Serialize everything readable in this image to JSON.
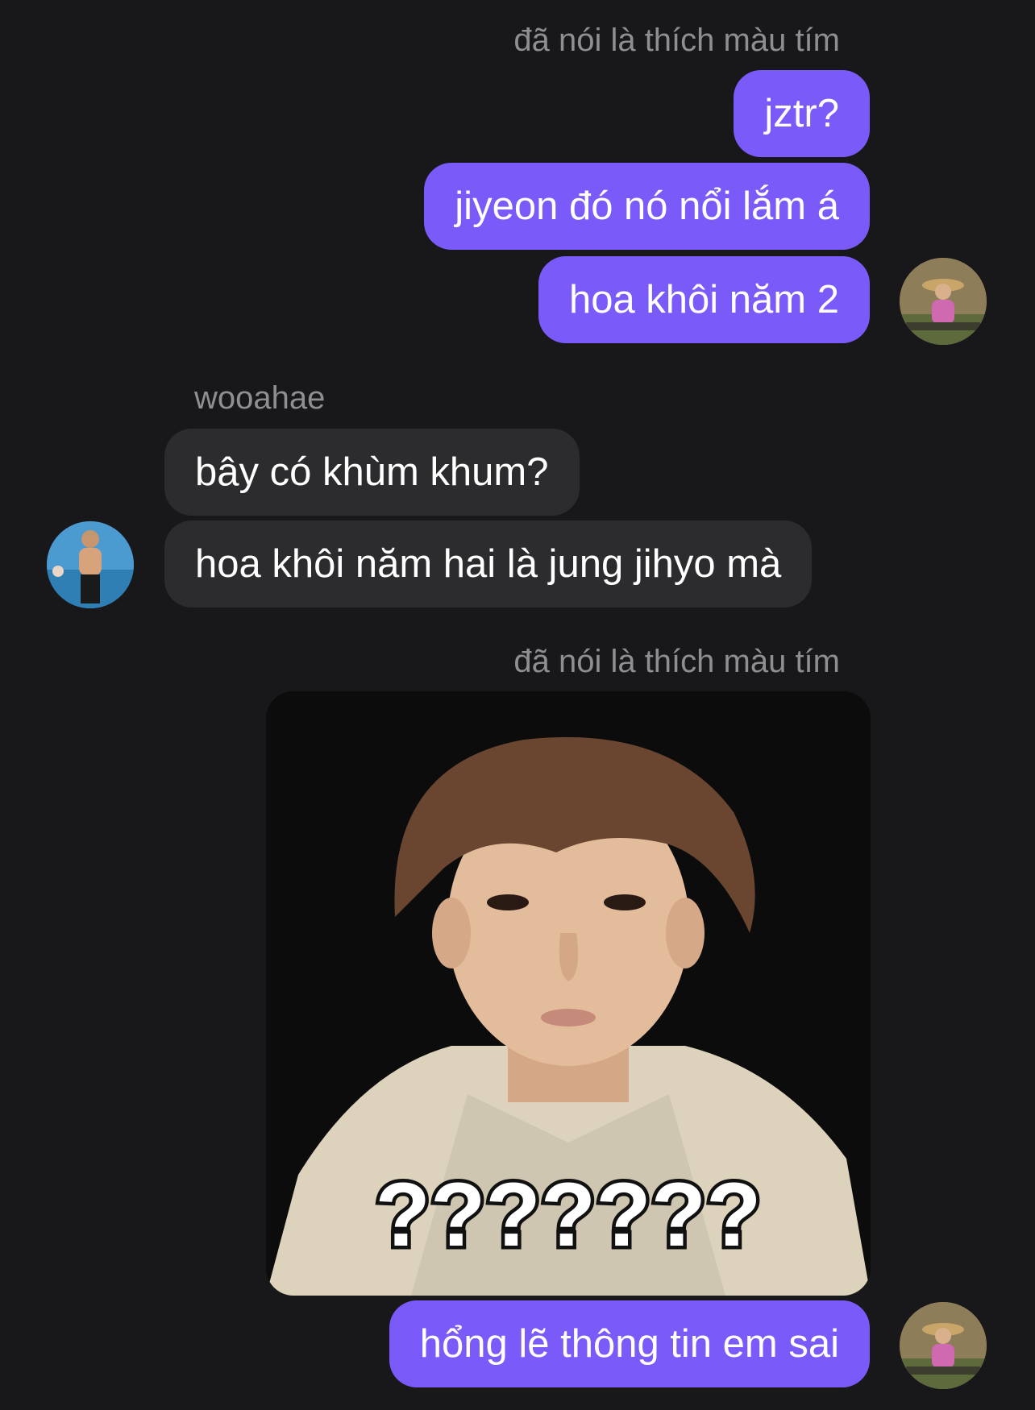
{
  "messages": {
    "group1_sender": "đã nói là thích màu tím",
    "group1": [
      "jztr?",
      "jiyeon đó nó nổi lắm á",
      "hoa khôi năm 2"
    ],
    "group2_sender": "wooahae",
    "group2": [
      "bây có khùm khum?",
      "hoa khôi năm hai là jung jihyo mà"
    ],
    "group3_sender": "đã nói là thích màu tím",
    "group3_image_caption": "???????",
    "group3_text": "hổng lẽ thông tin em sai"
  },
  "colors": {
    "background": "#18181a",
    "outgoing_bubble": "#7a5af8",
    "incoming_bubble": "#2c2c2e",
    "sender_name": "#8e8e93"
  }
}
